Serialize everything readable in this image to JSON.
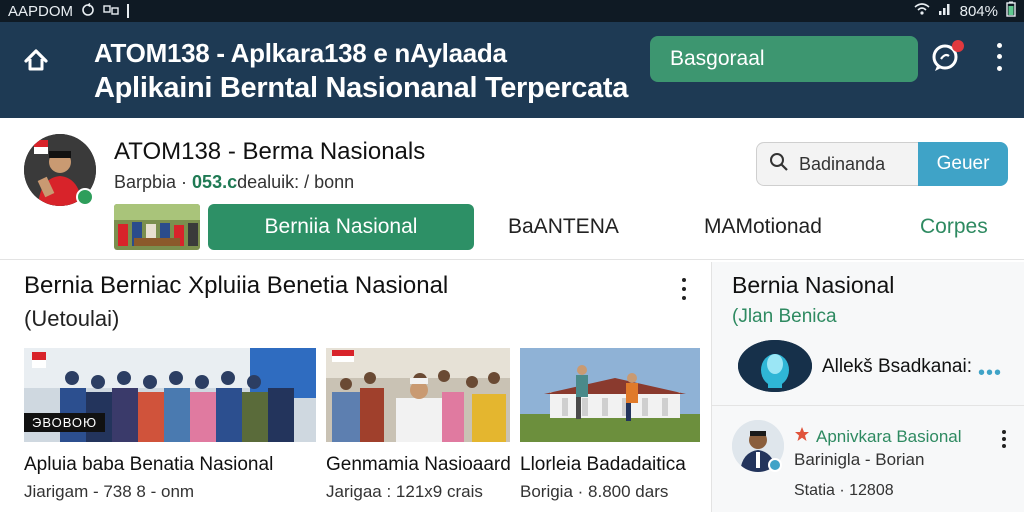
{
  "status_bar": {
    "left_text": "AAPDOM",
    "left_icons": [
      "sync-icon",
      "network-icon"
    ],
    "right_time": "804%",
    "right_icons": [
      "wifi-icon",
      "signal-icon",
      "battery-icon"
    ]
  },
  "app_bar": {
    "title_line1": "ATOM138 - Aplkara138 e nAylaada",
    "title_line2": "Aplikaini Berntal Nasionanal Terpercata",
    "action_button": "Basgoraal",
    "accent_color": "#3d9670",
    "bar_color": "#1e3a54"
  },
  "channel": {
    "name": "ATOM138 - Berma Nasionals",
    "sub_prefix": "Barpbia · ",
    "sub_accent": "053.c",
    "sub_suffix": "dealuik: / bonn",
    "search_value": "Badinanda",
    "search_button": "Geuer",
    "tabs": [
      "Berniia Nasional",
      "BaANTENA",
      "MAMotionad",
      "Corpes"
    ]
  },
  "main": {
    "section_title": "Bernia Berniac Xpluiia Benetia Nasional",
    "section_subtitle": "(Uetoulai)",
    "videos": [
      {
        "badge": "ЭВОВОЮ",
        "title": "Apluia baba Benatia Nasional",
        "meta": "Jiarigam - 738 8 - onm"
      },
      {
        "title": "Genmamia Nasioaard",
        "meta": "Jarigaa : 121x9 crais"
      },
      {
        "title": "Llorleia Badadaitica",
        "meta": "Borigia · 8.800 dars"
      }
    ]
  },
  "right_panel": {
    "title": "Bernia Nasional",
    "subtitle": "(Jlan Benica",
    "row1_label": "Allekš Bsadkanai:",
    "row1_dots": "•••",
    "row2_title": "Apnivkara Basional",
    "row2_sub": "Barinigla - Borian",
    "row2_meta": "Statia · 12808"
  }
}
